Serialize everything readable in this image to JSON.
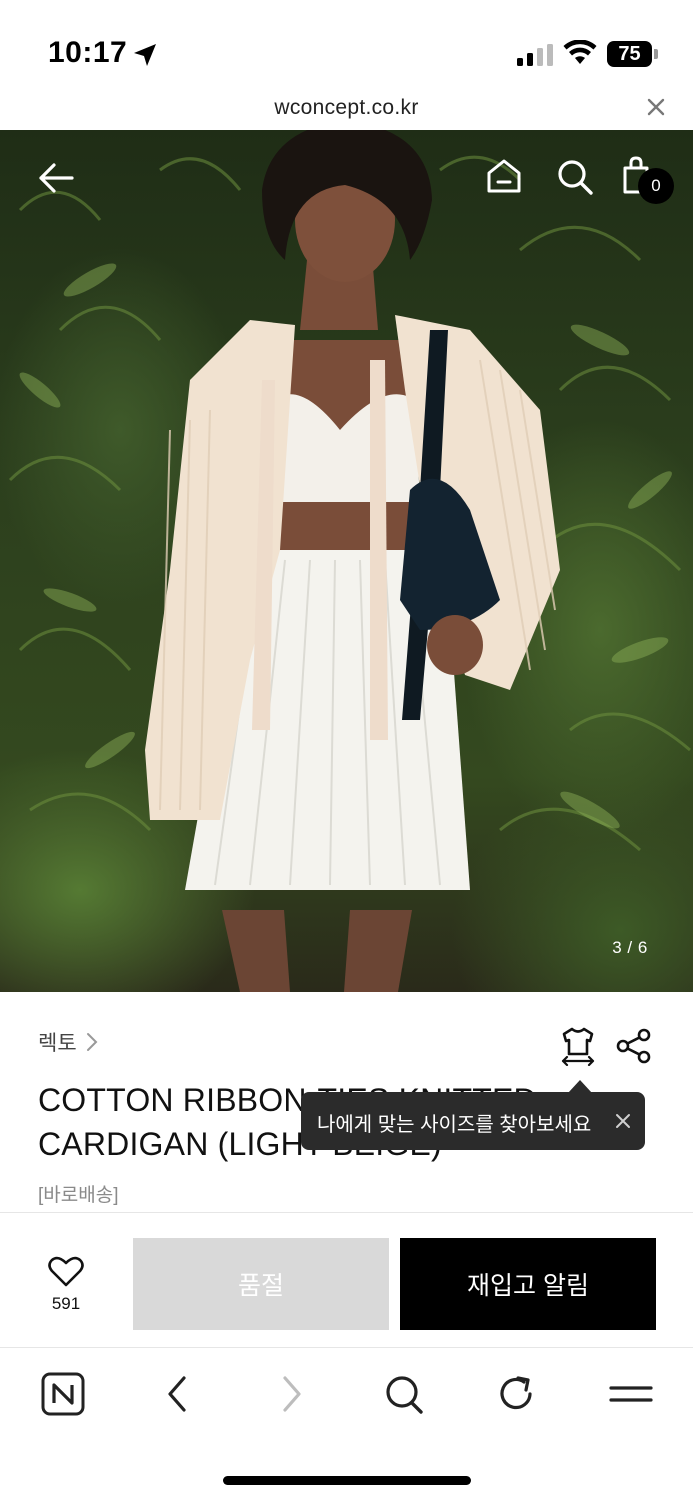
{
  "status_bar": {
    "time": "10:17",
    "battery": "75"
  },
  "url_bar": {
    "url": "wconcept.co.kr"
  },
  "hero": {
    "page_counter": "3 / 6",
    "cart_count": "0",
    "icons": [
      "back-arrow-icon",
      "home-icon",
      "search-icon",
      "shopping-bag-icon"
    ]
  },
  "product": {
    "brand": "렉토",
    "title_line1": "COTTON RIBBON-TIES KNITTED",
    "title_line2": "CARDIGAN (LIGHT BEIGE)",
    "delivery": "[바로배송]"
  },
  "tooltip": {
    "text": "나에게 맞는 사이즈를 찾아보세요"
  },
  "actions": {
    "wish_count": "591",
    "soldout_label": "품절",
    "restock_label": "재입고 알림"
  },
  "colors": {
    "primary": "#000000",
    "disabled": "#d9d9d9",
    "tooltip_bg": "#2b2b2b"
  }
}
